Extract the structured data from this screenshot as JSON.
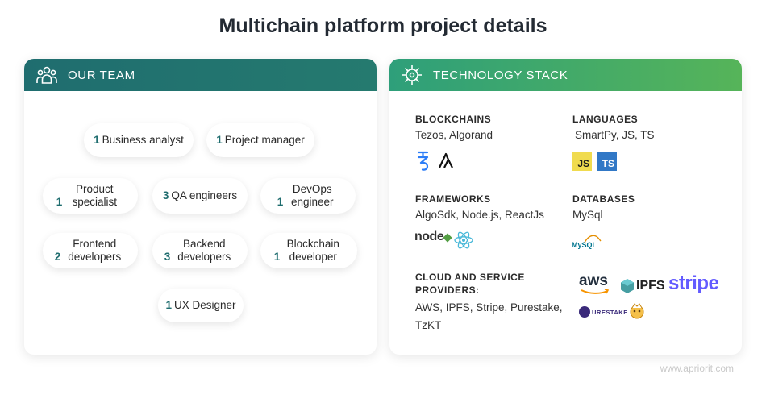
{
  "title": "Multichain platform project details",
  "team": {
    "header": "OUR TEAM",
    "members": [
      {
        "count": "1",
        "role": "Business analyst"
      },
      {
        "count": "1",
        "role": "Project manager"
      },
      {
        "count": "1",
        "role": "Product specialist"
      },
      {
        "count": "3",
        "role": "QA engineers"
      },
      {
        "count": "1",
        "role": "DevOps engineer"
      },
      {
        "count": "2",
        "role": "Frontend developers"
      },
      {
        "count": "3",
        "role": "Backend developers"
      },
      {
        "count": "1",
        "role": "Blockchain developer"
      },
      {
        "count": "1",
        "role": "UX Designer"
      }
    ]
  },
  "stack": {
    "header": "TECHNOLOGY STACK",
    "blockchains": {
      "title": "BLOCKCHAINS",
      "text": "Tezos, Algorand"
    },
    "languages": {
      "title": "LANGUAGES",
      "text": "SmartPy, JS, TS"
    },
    "frameworks": {
      "title": "FRAMEWORKS",
      "text": "AlgoSdk, Node.js, ReactJs"
    },
    "databases": {
      "title": "DATABASES",
      "text": "MySql"
    },
    "cloud": {
      "title": "CLOUD AND SERVICE PROVIDERS:",
      "text": "AWS, IPFS, Stripe, Purestake, TzKT"
    }
  },
  "logos": {
    "js": "JS",
    "ts": "TS",
    "node": "node",
    "mysql": "MySQL",
    "aws": "aws",
    "ipfs": "IPFS",
    "stripe": "stripe",
    "purestake": "URESTAKE"
  },
  "colors": {
    "teal": "#1f6d6f",
    "green": "#56b459",
    "stripe": "#635bff",
    "js_yellow": "#f0db4f",
    "ts_blue": "#3178c6"
  },
  "watermark": "www.apriorit.com"
}
